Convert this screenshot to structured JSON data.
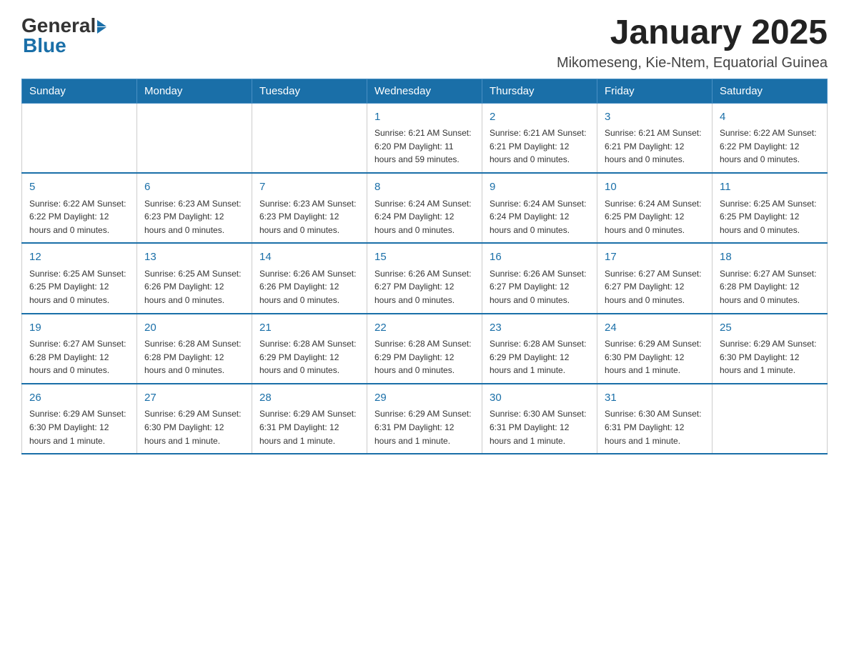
{
  "logo": {
    "general": "General",
    "blue": "Blue"
  },
  "header": {
    "month": "January 2025",
    "location": "Mikomeseng, Kie-Ntem, Equatorial Guinea"
  },
  "weekdays": [
    "Sunday",
    "Monday",
    "Tuesday",
    "Wednesday",
    "Thursday",
    "Friday",
    "Saturday"
  ],
  "weeks": [
    [
      {
        "day": "",
        "info": ""
      },
      {
        "day": "",
        "info": ""
      },
      {
        "day": "",
        "info": ""
      },
      {
        "day": "1",
        "info": "Sunrise: 6:21 AM\nSunset: 6:20 PM\nDaylight: 11 hours and 59 minutes."
      },
      {
        "day": "2",
        "info": "Sunrise: 6:21 AM\nSunset: 6:21 PM\nDaylight: 12 hours and 0 minutes."
      },
      {
        "day": "3",
        "info": "Sunrise: 6:21 AM\nSunset: 6:21 PM\nDaylight: 12 hours and 0 minutes."
      },
      {
        "day": "4",
        "info": "Sunrise: 6:22 AM\nSunset: 6:22 PM\nDaylight: 12 hours and 0 minutes."
      }
    ],
    [
      {
        "day": "5",
        "info": "Sunrise: 6:22 AM\nSunset: 6:22 PM\nDaylight: 12 hours and 0 minutes."
      },
      {
        "day": "6",
        "info": "Sunrise: 6:23 AM\nSunset: 6:23 PM\nDaylight: 12 hours and 0 minutes."
      },
      {
        "day": "7",
        "info": "Sunrise: 6:23 AM\nSunset: 6:23 PM\nDaylight: 12 hours and 0 minutes."
      },
      {
        "day": "8",
        "info": "Sunrise: 6:24 AM\nSunset: 6:24 PM\nDaylight: 12 hours and 0 minutes."
      },
      {
        "day": "9",
        "info": "Sunrise: 6:24 AM\nSunset: 6:24 PM\nDaylight: 12 hours and 0 minutes."
      },
      {
        "day": "10",
        "info": "Sunrise: 6:24 AM\nSunset: 6:25 PM\nDaylight: 12 hours and 0 minutes."
      },
      {
        "day": "11",
        "info": "Sunrise: 6:25 AM\nSunset: 6:25 PM\nDaylight: 12 hours and 0 minutes."
      }
    ],
    [
      {
        "day": "12",
        "info": "Sunrise: 6:25 AM\nSunset: 6:25 PM\nDaylight: 12 hours and 0 minutes."
      },
      {
        "day": "13",
        "info": "Sunrise: 6:25 AM\nSunset: 6:26 PM\nDaylight: 12 hours and 0 minutes."
      },
      {
        "day": "14",
        "info": "Sunrise: 6:26 AM\nSunset: 6:26 PM\nDaylight: 12 hours and 0 minutes."
      },
      {
        "day": "15",
        "info": "Sunrise: 6:26 AM\nSunset: 6:27 PM\nDaylight: 12 hours and 0 minutes."
      },
      {
        "day": "16",
        "info": "Sunrise: 6:26 AM\nSunset: 6:27 PM\nDaylight: 12 hours and 0 minutes."
      },
      {
        "day": "17",
        "info": "Sunrise: 6:27 AM\nSunset: 6:27 PM\nDaylight: 12 hours and 0 minutes."
      },
      {
        "day": "18",
        "info": "Sunrise: 6:27 AM\nSunset: 6:28 PM\nDaylight: 12 hours and 0 minutes."
      }
    ],
    [
      {
        "day": "19",
        "info": "Sunrise: 6:27 AM\nSunset: 6:28 PM\nDaylight: 12 hours and 0 minutes."
      },
      {
        "day": "20",
        "info": "Sunrise: 6:28 AM\nSunset: 6:28 PM\nDaylight: 12 hours and 0 minutes."
      },
      {
        "day": "21",
        "info": "Sunrise: 6:28 AM\nSunset: 6:29 PM\nDaylight: 12 hours and 0 minutes."
      },
      {
        "day": "22",
        "info": "Sunrise: 6:28 AM\nSunset: 6:29 PM\nDaylight: 12 hours and 0 minutes."
      },
      {
        "day": "23",
        "info": "Sunrise: 6:28 AM\nSunset: 6:29 PM\nDaylight: 12 hours and 1 minute."
      },
      {
        "day": "24",
        "info": "Sunrise: 6:29 AM\nSunset: 6:30 PM\nDaylight: 12 hours and 1 minute."
      },
      {
        "day": "25",
        "info": "Sunrise: 6:29 AM\nSunset: 6:30 PM\nDaylight: 12 hours and 1 minute."
      }
    ],
    [
      {
        "day": "26",
        "info": "Sunrise: 6:29 AM\nSunset: 6:30 PM\nDaylight: 12 hours and 1 minute."
      },
      {
        "day": "27",
        "info": "Sunrise: 6:29 AM\nSunset: 6:30 PM\nDaylight: 12 hours and 1 minute."
      },
      {
        "day": "28",
        "info": "Sunrise: 6:29 AM\nSunset: 6:31 PM\nDaylight: 12 hours and 1 minute."
      },
      {
        "day": "29",
        "info": "Sunrise: 6:29 AM\nSunset: 6:31 PM\nDaylight: 12 hours and 1 minute."
      },
      {
        "day": "30",
        "info": "Sunrise: 6:30 AM\nSunset: 6:31 PM\nDaylight: 12 hours and 1 minute."
      },
      {
        "day": "31",
        "info": "Sunrise: 6:30 AM\nSunset: 6:31 PM\nDaylight: 12 hours and 1 minute."
      },
      {
        "day": "",
        "info": ""
      }
    ]
  ]
}
